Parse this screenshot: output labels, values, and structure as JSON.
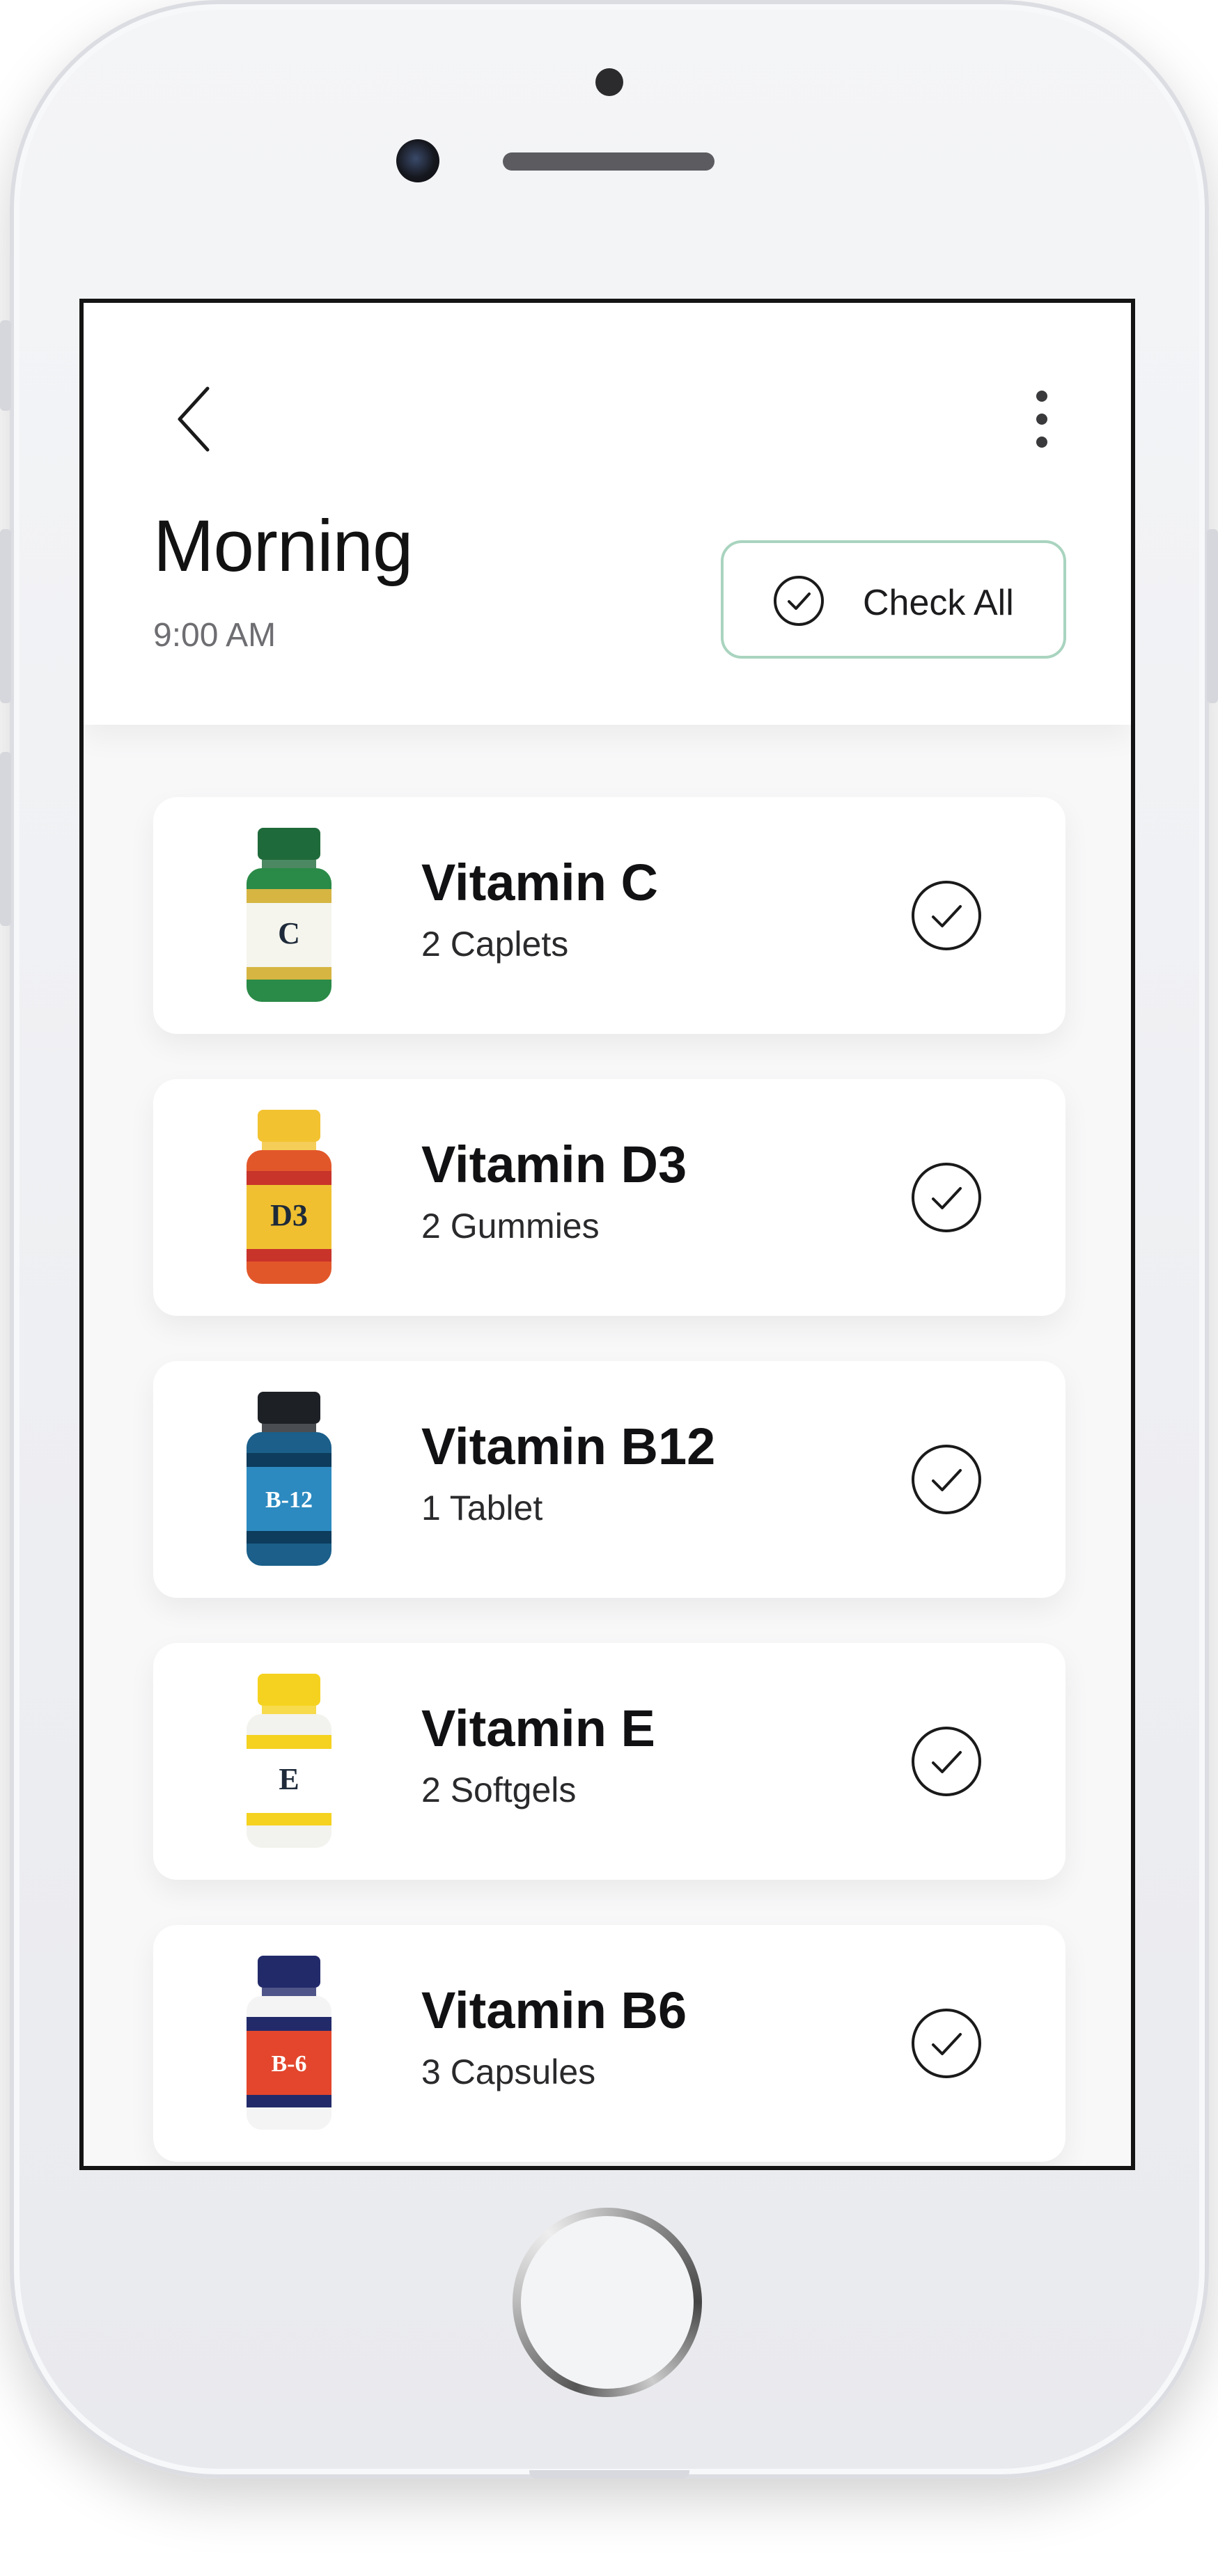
{
  "header": {
    "title": "Morning",
    "subtitle": "9:00 AM",
    "check_all_label": "Check All",
    "back_icon": "chevron-left-icon",
    "menu_icon": "more-vertical-icon",
    "accent_color": "#a9d4bf"
  },
  "medications": [
    {
      "name": "Vitamin C",
      "dose": "2 Caplets",
      "icon": "bottle-vitamin-c",
      "bottle": {
        "cap": "#1f6a3a",
        "body": "#2a8a47",
        "label": "#f5f5ee",
        "band": "#d6b542",
        "text": "C"
      }
    },
    {
      "name": "Vitamin D3",
      "dose": "2 Gummies",
      "icon": "bottle-vitamin-d3",
      "bottle": {
        "cap": "#f2c230",
        "body": "#e2572a",
        "label": "#f0c030",
        "band": "#c8332a",
        "text": "D3"
      }
    },
    {
      "name": "Vitamin B12",
      "dose": "1 Tablet",
      "icon": "bottle-vitamin-b12",
      "bottle": {
        "cap": "#1d2126",
        "body": "#1b5f8a",
        "label": "#2c8ac0",
        "band": "#0d3c5c",
        "text": "B-12"
      }
    },
    {
      "name": "Vitamin E",
      "dose": "2 Softgels",
      "icon": "bottle-vitamin-e",
      "bottle": {
        "cap": "#f5d21f",
        "body": "#f2f2ee",
        "label": "#ffffff",
        "band": "#f5d21f",
        "text": "E"
      }
    },
    {
      "name": "Vitamin B6",
      "dose": "3 Capsules",
      "icon": "bottle-vitamin-b6",
      "bottle": {
        "cap": "#232a6a",
        "body": "#f4f4f4",
        "label": "#e3462c",
        "band": "#232a6a",
        "text": "B-6"
      }
    }
  ]
}
